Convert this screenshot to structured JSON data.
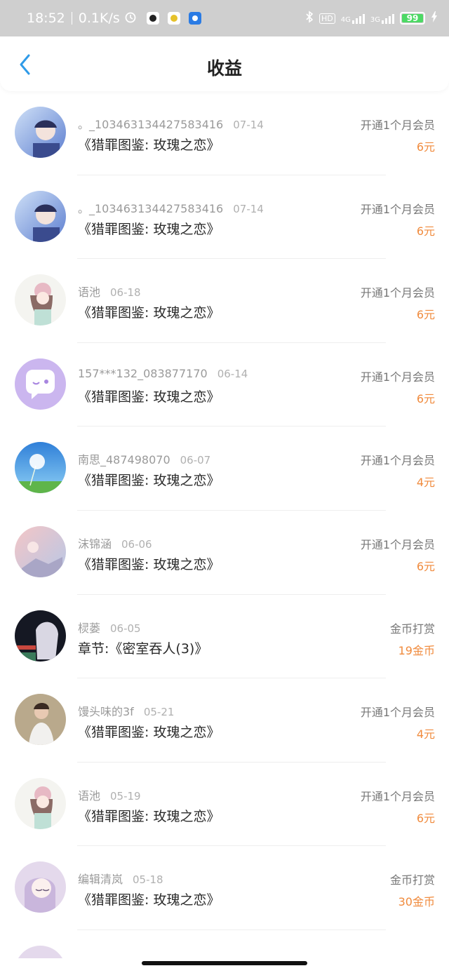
{
  "status_bar": {
    "time": "18:52",
    "speed": "0.1K/s",
    "battery": "99",
    "hd_label": "HD",
    "net_4g": "4G",
    "net_3g": "3G"
  },
  "header": {
    "title": "收益"
  },
  "items": [
    {
      "user": "。_103463134427583416",
      "date": "07-14",
      "title": "《猎罪图鉴: 玫瑰之恋》",
      "type": "开通1个月会员",
      "amount": "6元"
    },
    {
      "user": "。_103463134427583416",
      "date": "07-14",
      "title": "《猎罪图鉴: 玫瑰之恋》",
      "type": "开通1个月会员",
      "amount": "6元"
    },
    {
      "user": "语池",
      "date": "06-18",
      "title": "《猎罪图鉴: 玫瑰之恋》",
      "type": "开通1个月会员",
      "amount": "6元"
    },
    {
      "user": "157***132_083877170",
      "date": "06-14",
      "title": "《猎罪图鉴: 玫瑰之恋》",
      "type": "开通1个月会员",
      "amount": "6元"
    },
    {
      "user": "南思_487498070",
      "date": "06-07",
      "title": "《猎罪图鉴: 玫瑰之恋》",
      "type": "开通1个月会员",
      "amount": "4元"
    },
    {
      "user": "沫锦涵",
      "date": "06-06",
      "title": "《猎罪图鉴: 玫瑰之恋》",
      "type": "开通1个月会员",
      "amount": "6元"
    },
    {
      "user": "棂蒌",
      "date": "06-05",
      "title": "章节:《密室吞人(3)》",
      "type": "金币打赏",
      "amount": "19金币"
    },
    {
      "user": "馒头味的3f",
      "date": "05-21",
      "title": "《猎罪图鉴: 玫瑰之恋》",
      "type": "开通1个月会员",
      "amount": "4元"
    },
    {
      "user": "语池",
      "date": "05-19",
      "title": "《猎罪图鉴: 玫瑰之恋》",
      "type": "开通1个月会员",
      "amount": "6元"
    },
    {
      "user": "编辑清岚",
      "date": "05-18",
      "title": "《猎罪图鉴: 玫瑰之恋》",
      "type": "金币打赏",
      "amount": "30金币"
    }
  ],
  "colors": {
    "accent": "#2f9be8",
    "amount": "#f08a3c",
    "status_bar": "#cfcfcf"
  }
}
